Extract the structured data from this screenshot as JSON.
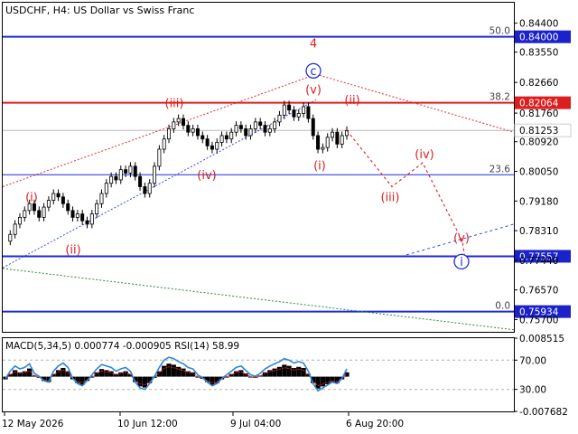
{
  "header": {
    "title": "USDCHF, H4:  US Dollar vs Swiss Franc"
  },
  "colors": {
    "red": "#dd1e1e",
    "blue": "#1f2bd6",
    "price_text_bg_blue": "#1a22c8",
    "price_text_bg_red": "#dd1e1e",
    "dotted_red": "#d83030",
    "dotted_blue": "#3a4ae0",
    "dotted_green": "#2d8a2d",
    "gray": "#b8b8b8"
  },
  "chart_data": [
    {
      "type": "line",
      "panel": "price",
      "y_ticks": [
        "0.84400",
        "0.83550",
        "0.82660",
        "0.81760",
        "0.80920",
        "0.80050",
        "0.79180",
        "0.78310",
        "0.77440",
        "0.76570",
        "0.75700"
      ],
      "ylim": [
        0.7534,
        0.85
      ],
      "x_ticks": [
        "12 May 2026",
        "10 Jun 12:00",
        "9 Jul 04:00",
        "6 Aug 20:00"
      ],
      "levels": [
        {
          "value": 0.84,
          "label": "0.84000",
          "fib": "50.0",
          "color": "blue"
        },
        {
          "value": 0.82064,
          "label": "0.82064",
          "fib": "38.2",
          "color": "red"
        },
        {
          "value": 0.81253,
          "label": "0.81253",
          "fib": "",
          "color": "gray"
        },
        {
          "value": 0.7995,
          "label": "",
          "fib": "23.6",
          "color": "blue"
        },
        {
          "value": 0.77557,
          "label": "0.77557",
          "fib": "",
          "color": "blue"
        },
        {
          "value": 0.75934,
          "label": "0.75934",
          "fib": "0.0",
          "color": "blue"
        }
      ],
      "series": [
        {
          "values": [
            0.78,
            0.782,
            0.785,
            0.787,
            0.789,
            0.791,
            0.789,
            0.787,
            0.79,
            0.792,
            0.794,
            0.793,
            0.791,
            0.789,
            0.787,
            0.788,
            0.786,
            0.785,
            0.788,
            0.791,
            0.794,
            0.797,
            0.799,
            0.798,
            0.801,
            0.8,
            0.802,
            0.799,
            0.796,
            0.794,
            0.797,
            0.802,
            0.807,
            0.81,
            0.813,
            0.815,
            0.816,
            0.814,
            0.812,
            0.813,
            0.811,
            0.81,
            0.808,
            0.807,
            0.809,
            0.811,
            0.81,
            0.812,
            0.814,
            0.813,
            0.811,
            0.813,
            0.815,
            0.814,
            0.812,
            0.813,
            0.815,
            0.817,
            0.82,
            0.8185,
            0.8165,
            0.8175,
            0.8195,
            0.816,
            0.811,
            0.807,
            0.8075,
            0.8105,
            0.812,
            0.8085,
            0.811,
            0.8125
          ]
        }
      ],
      "wave_labels": [
        {
          "text": "(i)",
          "color": "red"
        },
        {
          "text": "(ii)",
          "color": "red"
        },
        {
          "text": "(iii)",
          "color": "red"
        },
        {
          "text": "(iv)",
          "color": "red"
        },
        {
          "text": "(v)",
          "color": "red"
        },
        {
          "text": "4",
          "color": "red"
        },
        {
          "text": "c",
          "color": "blue",
          "circled": true
        },
        {
          "text": "(i)",
          "color": "red"
        },
        {
          "text": "(ii)",
          "color": "red"
        },
        {
          "text": "(iii)",
          "color": "red"
        },
        {
          "text": "(iv)",
          "color": "red"
        },
        {
          "text": "(v)",
          "color": "red"
        },
        {
          "text": "i",
          "color": "blue",
          "circled": true
        }
      ],
      "forecast_path": [
        0.8125,
        0.796,
        0.803,
        0.78,
        0.7745
      ]
    },
    {
      "type": "line",
      "panel": "indicator",
      "label": "MACD(5,34,5) 0.000774 -0.000905 RSI(14) 58.99",
      "y_ticks": [
        "0.008515",
        "70.00",
        "30.00",
        "-0.007682"
      ],
      "ylim": [
        -0.007682,
        0.008515
      ],
      "rsi_levels": [
        70,
        30
      ],
      "rsi": [
        45,
        55,
        62,
        58,
        60,
        65,
        52,
        48,
        42,
        40,
        55,
        62,
        66,
        60,
        45,
        38,
        35,
        42,
        50,
        58,
        64,
        62,
        60,
        55,
        58,
        60,
        55,
        40,
        32,
        30,
        38,
        48,
        60,
        70,
        74,
        72,
        68,
        65,
        60,
        58,
        50,
        46,
        40,
        35,
        38,
        45,
        50,
        55,
        60,
        62,
        56,
        50,
        48,
        52,
        58,
        62,
        65,
        68,
        72,
        70,
        66,
        68,
        66,
        55,
        38,
        28,
        32,
        36,
        40,
        38,
        45,
        58
      ]
    }
  ]
}
